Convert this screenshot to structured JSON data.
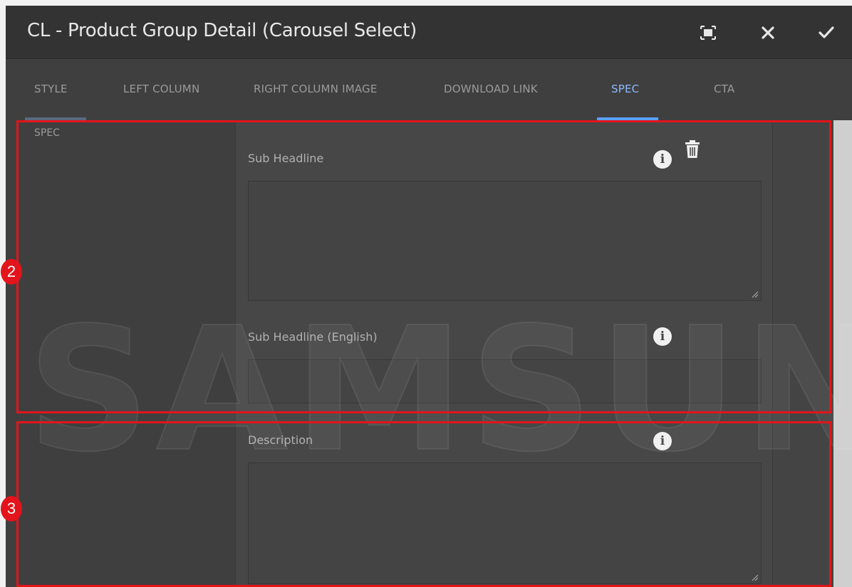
{
  "dialog": {
    "title": "CL - Product Group Detail (Carousel Select)",
    "buttons": {
      "fullscreen": "fullscreen-icon",
      "close": "close-icon",
      "confirm": "check-icon"
    }
  },
  "tabs": [
    {
      "label": "STYLE",
      "active": false
    },
    {
      "label": "LEFT COLUMN",
      "active": false
    },
    {
      "label": "RIGHT COLUMN IMAGE",
      "active": false
    },
    {
      "label": "DOWNLOAD LINK",
      "active": false
    },
    {
      "label": "SPEC",
      "active": true
    },
    {
      "label": "CTA",
      "active": false
    }
  ],
  "section": {
    "label": "SPEC"
  },
  "fields": {
    "sub_headline": {
      "label": "Sub Headline",
      "value": ""
    },
    "sub_headline_english": {
      "label": "Sub Headline (English)",
      "value": ""
    },
    "description": {
      "label": "Description",
      "value": ""
    }
  },
  "watermark": "SAMSUNG",
  "annotations": [
    {
      "number": "2"
    },
    {
      "number": "3"
    }
  ],
  "colors": {
    "accent": "#5aa0ff",
    "annotation": "#e3141b"
  }
}
